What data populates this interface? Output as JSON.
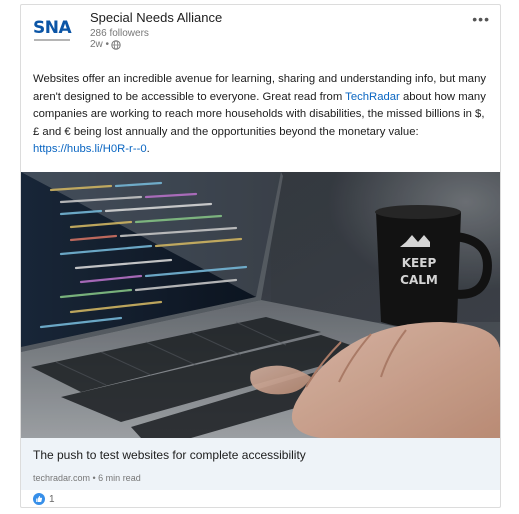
{
  "post": {
    "author_name": "Special Needs Alliance",
    "logo_text": "SNA",
    "followers": "286 followers",
    "time": "2w •",
    "more_label": "•••",
    "text_part1": "Websites offer an incredible avenue for learning, sharing and understanding info, but many aren't designed to be accessible to everyone. Great read from ",
    "mention": "TechRadar",
    "text_part2": " about how many companies are working to reach more households with disabilities, the missed billions in $, £ and € being lost annually and the opportunities beyond the monetary value: ",
    "link_text": "https://hubs.li/H0R-r--0",
    "text_end": ".",
    "reaction_count": "1"
  },
  "article": {
    "title": "The push to test websites for complete accessibility",
    "source": "techradar.com • 6 min read",
    "mug_text_line1": "KEEP",
    "mug_text_line2": "CALM"
  },
  "icons": {
    "globe": "globe-icon",
    "like": "like-icon",
    "more": "more-icon"
  },
  "colors": {
    "link": "#0a66c2",
    "logo": "#0b55a6",
    "like": "#378fe9"
  }
}
